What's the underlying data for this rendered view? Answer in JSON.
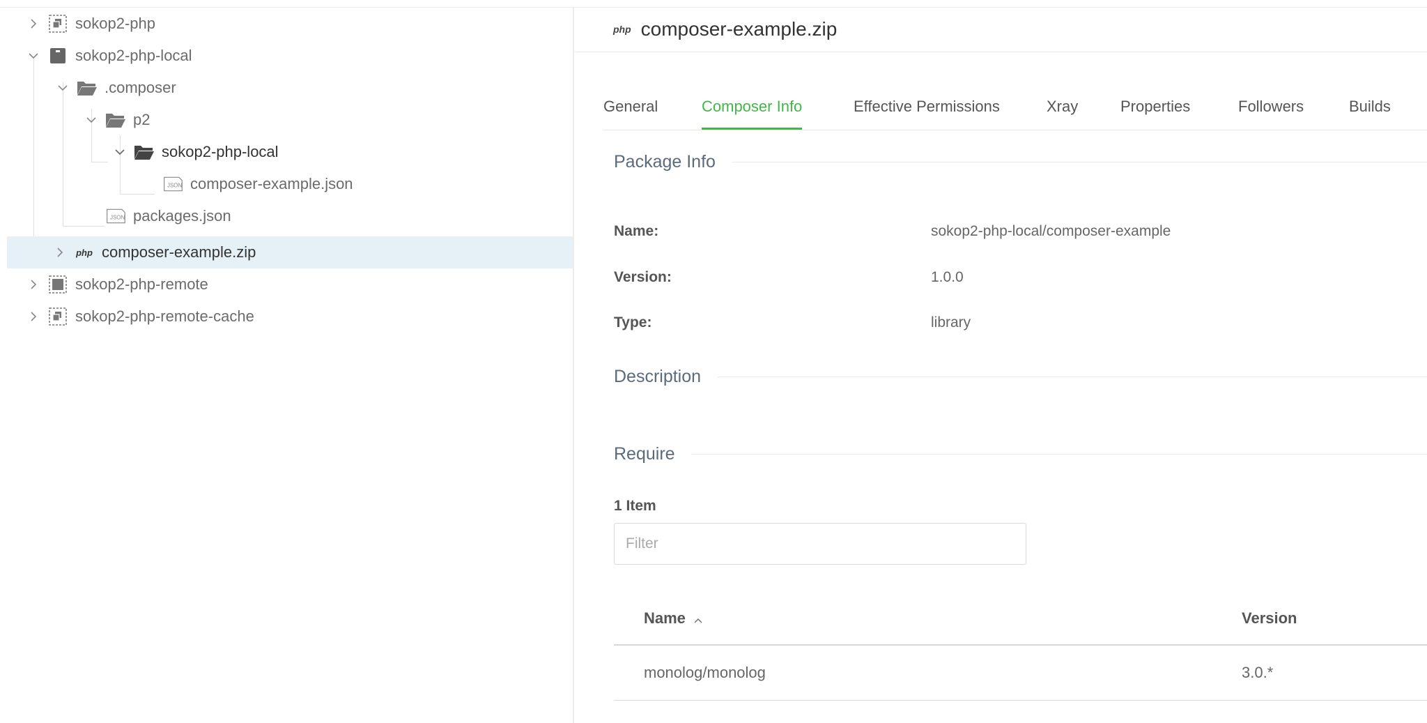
{
  "tree": {
    "items": [
      {
        "label": "sokop2-php",
        "icon": "virtual-repo-icon"
      },
      {
        "label": "sokop2-php-local",
        "icon": "local-repo-icon"
      },
      {
        "label": ".composer",
        "icon": "folder-open-icon"
      },
      {
        "label": "p2",
        "icon": "folder-open-icon"
      },
      {
        "label": "sokop2-php-local",
        "icon": "folder-open-icon"
      },
      {
        "label": "composer-example.json",
        "icon": "json-file-icon"
      },
      {
        "label": "packages.json",
        "icon": "json-file-icon"
      },
      {
        "label": "composer-example.zip",
        "icon": "php-package-icon"
      },
      {
        "label": "sokop2-php-remote",
        "icon": "remote-repo-icon"
      },
      {
        "label": "sokop2-php-remote-cache",
        "icon": "virtual-repo-icon"
      }
    ],
    "selected_color": "#e6f1f7"
  },
  "header": {
    "badge": "php",
    "title": "composer-example.zip"
  },
  "tabs": [
    {
      "label": "General"
    },
    {
      "label": "Composer Info"
    },
    {
      "label": "Effective Permissions"
    },
    {
      "label": "Xray"
    },
    {
      "label": "Properties"
    },
    {
      "label": "Followers"
    },
    {
      "label": "Builds"
    }
  ],
  "active_tab": "Composer Info",
  "accent_color": "#43b649",
  "package_info": {
    "section_title": "Package Info",
    "name_label": "Name:",
    "name_value": "sokop2-php-local/composer-example",
    "version_label": "Version:",
    "version_value": "1.0.0",
    "type_label": "Type:",
    "type_value": "library"
  },
  "description": {
    "section_title": "Description"
  },
  "require": {
    "section_title": "Require",
    "count": "1 Item",
    "filter_placeholder": "Filter",
    "columns": {
      "name": "Name",
      "version": "Version"
    },
    "sort": "ascending",
    "rows": [
      {
        "name": "monolog/monolog",
        "version": "3.0.*"
      }
    ]
  }
}
